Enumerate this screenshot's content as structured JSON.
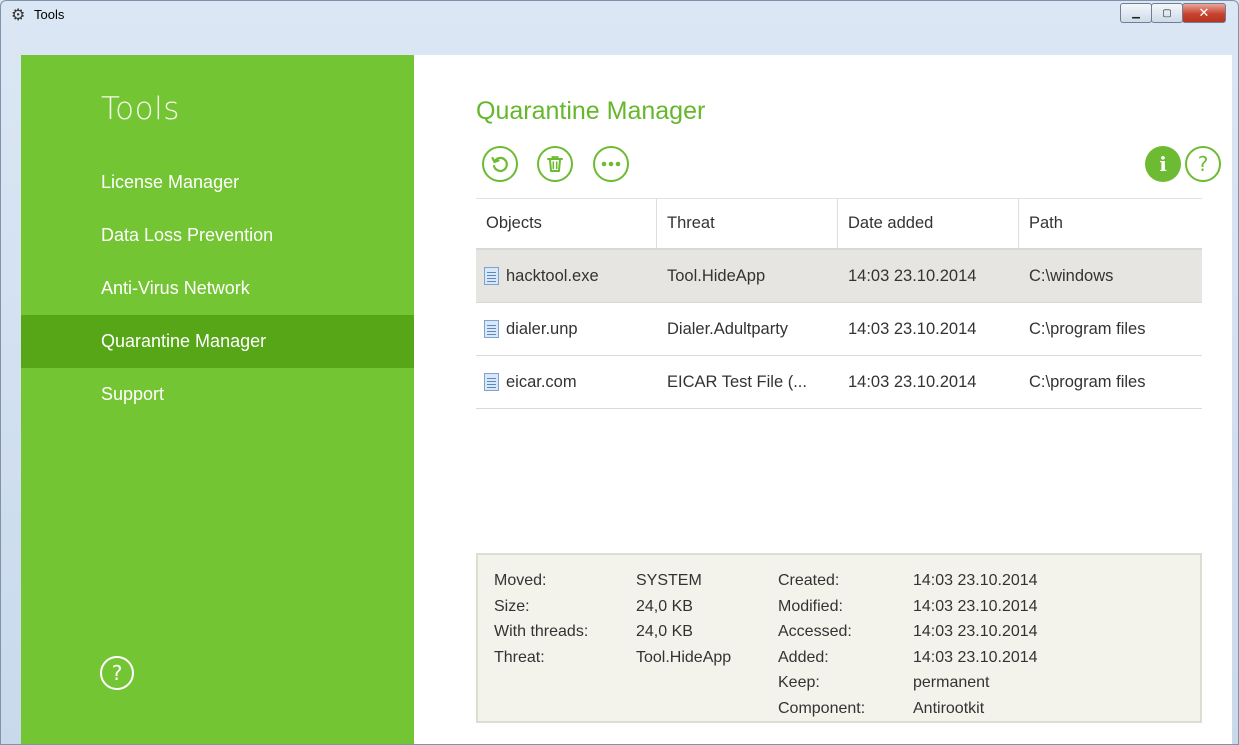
{
  "window": {
    "title": "Tools",
    "icon": "gear-icon"
  },
  "sidebar": {
    "title": "Tools",
    "items": [
      {
        "label": "License Manager",
        "active": false
      },
      {
        "label": "Data Loss Prevention",
        "active": false
      },
      {
        "label": "Anti-Virus Network",
        "active": false
      },
      {
        "label": "Quarantine Manager",
        "active": true
      },
      {
        "label": "Support",
        "active": false
      }
    ],
    "help_icon": "help-icon"
  },
  "main": {
    "title": "Quarantine Manager",
    "toolbar": {
      "restore_icon": "restore-icon",
      "delete_icon": "trash-icon",
      "more_icon": "more-icon",
      "info_label": "i",
      "help_label": "?"
    },
    "table": {
      "columns": [
        "Objects",
        "Threat",
        "Date added",
        "Path"
      ],
      "rows": [
        {
          "object": "hacktool.exe",
          "threat": "Tool.HideApp",
          "date": "14:03 23.10.2014",
          "path": "C:\\windows"
        },
        {
          "object": "dialer.unp",
          "threat": "Dialer.Adultparty",
          "date": "14:03 23.10.2014",
          "path": "C:\\program files"
        },
        {
          "object": "eicar.com",
          "threat": "EICAR Test File (...",
          "date": "14:03 23.10.2014",
          "path": "C:\\program files"
        }
      ]
    },
    "details": {
      "left_labels": [
        "Moved:",
        "Size:",
        "With threads:",
        "Threat:"
      ],
      "left_values": [
        "SYSTEM",
        "24,0 KB",
        "24,0 KB",
        "Tool.HideApp"
      ],
      "right_labels": [
        "Created:",
        "Modified:",
        "Accessed:",
        "Added:",
        "Keep:",
        "Component:"
      ],
      "right_values": [
        "14:03 23.10.2014",
        "14:03 23.10.2014",
        "14:03 23.10.2014",
        "14:03 23.10.2014",
        "permanent",
        "Antirootkit"
      ]
    }
  },
  "colors": {
    "sidebar": "#74c533",
    "sidebar_active": "#56a618",
    "accent": "#6dbb32",
    "selected_row": "#e6e5e2"
  }
}
